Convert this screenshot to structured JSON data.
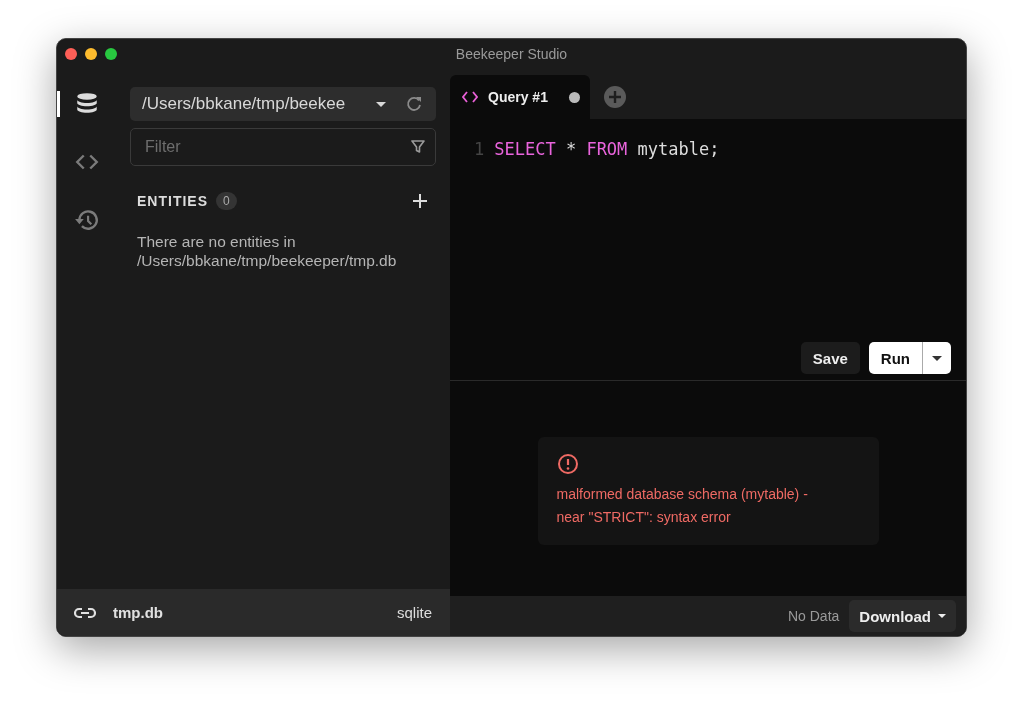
{
  "window": {
    "title": "Beekeeper Studio"
  },
  "rail": [
    {
      "kind": "database",
      "selected": true
    },
    {
      "kind": "code",
      "selected": false
    },
    {
      "kind": "history",
      "selected": false
    }
  ],
  "connection_select": {
    "value": "/Users/bbkane/tmp/beekee"
  },
  "filter": {
    "placeholder": "Filter"
  },
  "entities": {
    "heading": "ENTITIES",
    "count": "0",
    "empty_message": "There are no entities in /Users/bbkane/tmp/beekeeper/tmp.db"
  },
  "connection_footer": {
    "name": "tmp.db",
    "type": "sqlite"
  },
  "tabs": [
    {
      "label": "Query #1",
      "selected": true,
      "unsaved": true
    }
  ],
  "editor": {
    "lines": [
      {
        "number": "1",
        "tokens": [
          {
            "kind": "keyword",
            "text": "SELECT"
          },
          {
            "kind": "plain",
            "text": " * "
          },
          {
            "kind": "keyword",
            "text": "FROM"
          },
          {
            "kind": "plain",
            "text": " mytable;"
          }
        ]
      }
    ]
  },
  "actions": {
    "save": "Save",
    "run": "Run"
  },
  "error": {
    "message": "malformed database schema (mytable) - near \"STRICT\": syntax error"
  },
  "results_footer": {
    "status": "No Data",
    "download": "Download"
  }
}
